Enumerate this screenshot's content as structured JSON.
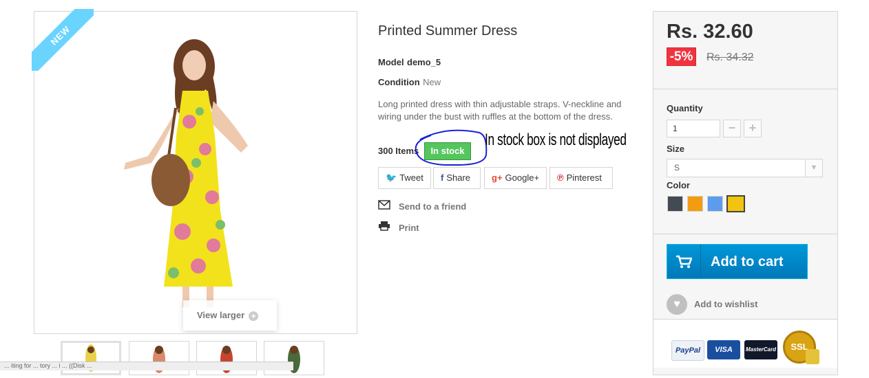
{
  "product": {
    "title": "Printed Summer Dress",
    "model_label": "Model",
    "model_value": "demo_5",
    "condition_label": "Condition",
    "condition_value": "New",
    "description": "Long printed dress with thin adjustable straps. V-neckline and wiring under the bust with ruffles at the bottom of the dress.",
    "quantity_text": "300 Items",
    "stock_badge": "In stock",
    "new_ribbon": "NEW",
    "view_larger": "View larger",
    "annotation": "In stock box is not displayed"
  },
  "social": {
    "tweet": "Tweet",
    "share": "Share",
    "google": "Google+",
    "pinterest": "Pinterest"
  },
  "links": {
    "send_to_friend": "Send to a friend",
    "print": "Print"
  },
  "buy_box": {
    "price": "Rs. 32.60",
    "discount": "-5%",
    "old_price": "Rs. 34.32",
    "quantity_label": "Quantity",
    "quantity_value": "1",
    "size_label": "Size",
    "size_value": "S",
    "color_label": "Color",
    "colors": [
      "#434a54",
      "#f39c11",
      "#5d9cec",
      "#f1c40f"
    ],
    "selected_color_index": 3,
    "add_to_cart": "Add to cart",
    "add_to_wishlist": "Add to wishlist"
  },
  "payments": {
    "paypal": "PayPal",
    "visa": "VISA",
    "mastercard": "MasterCard",
    "ssl": "SSL"
  },
  "status_bar": "... iting for ... tory ... i ... ((Disk ..."
}
